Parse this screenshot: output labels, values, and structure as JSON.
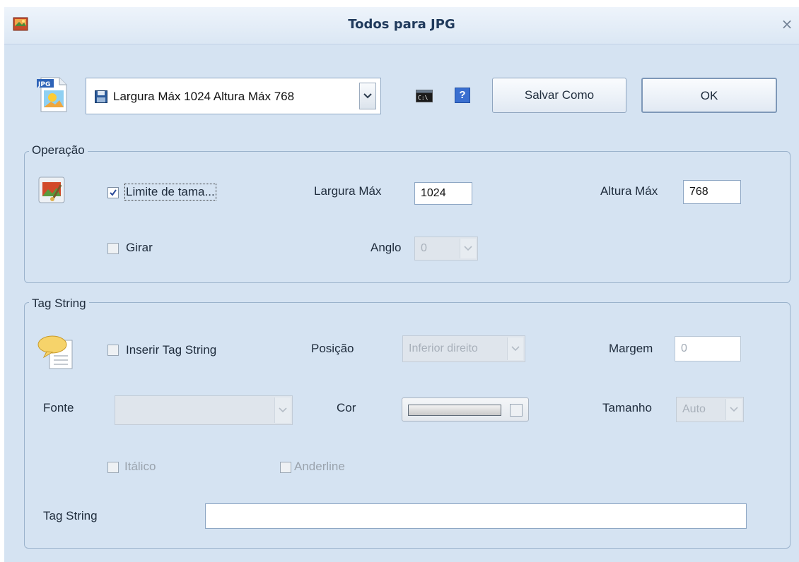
{
  "window": {
    "title": "Todos para JPG",
    "close_glyph": "×",
    "app_icon": "image-converter-icon"
  },
  "toolbar": {
    "format_icon": "jpg-file-icon",
    "preset_value": "Largura Máx 1024 Altura Máx 768",
    "preset_icon": "floppy-disk-icon",
    "console_icon": "command-prompt-icon",
    "help_label": "?",
    "save_as_label": "Salvar Como",
    "ok_label": "OK"
  },
  "operation": {
    "legend": "Operação",
    "icon": "paint-brush-icon",
    "size_limit": {
      "label": "Limite de tama...",
      "checked": true
    },
    "max_width": {
      "label": "Largura Máx",
      "value": "1024"
    },
    "max_height": {
      "label": "Altura Máx",
      "value": "768"
    },
    "rotate": {
      "label": "Girar",
      "checked": false
    },
    "angle": {
      "label": "Anglo",
      "value": "0"
    }
  },
  "tag_string": {
    "legend": "Tag String",
    "icon": "speech-bubble-document-icon",
    "insert": {
      "label": "Inserir Tag String",
      "checked": false
    },
    "position": {
      "label": "Posição",
      "value": "Inferior direito"
    },
    "margin": {
      "label": "Margem",
      "value": "0"
    },
    "font": {
      "label": "Fonte",
      "value": ""
    },
    "color": {
      "label": "Cor"
    },
    "size": {
      "label": "Tamanho",
      "value": "Auto"
    },
    "italic": {
      "label": "Itálico",
      "checked": false
    },
    "underline": {
      "label": "Anderline",
      "checked": false
    },
    "text": {
      "label": "Tag String",
      "value": ""
    }
  },
  "colors": {
    "window_bg": "#d5e3f2",
    "group_border": "#9bb3cc",
    "title_text": "#203a5c",
    "disabled_text": "#9aa3ad"
  }
}
